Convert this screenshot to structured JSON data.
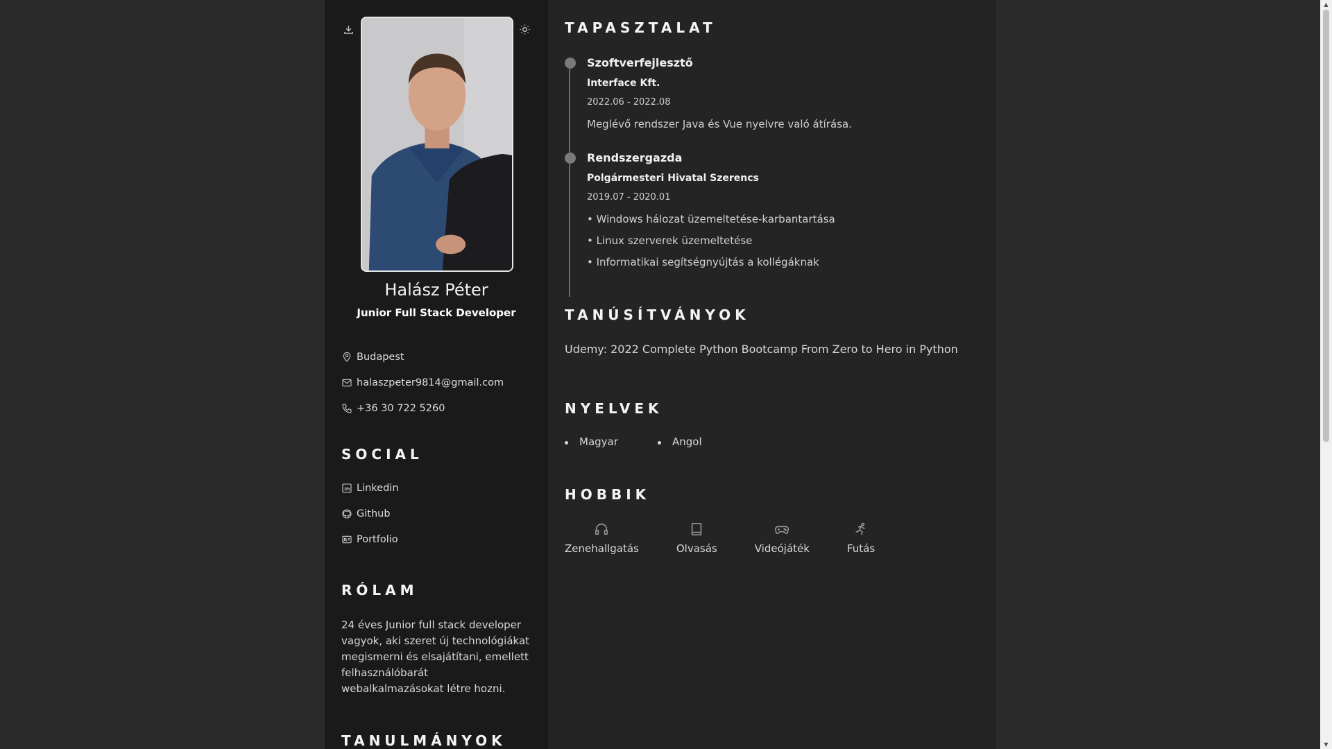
{
  "profile": {
    "name": "Halász Péter",
    "role": "Junior Full Stack Developer"
  },
  "toolbar": {
    "download_icon": "download-icon",
    "theme_icon": "sun-icon"
  },
  "contact": [
    {
      "icon": "location-icon",
      "text": "Budapest"
    },
    {
      "icon": "mail-icon",
      "text": "halaszpeter9814@gmail.com"
    },
    {
      "icon": "phone-icon",
      "text": "+36 30 722 5260"
    }
  ],
  "social": {
    "title": "SOCIAL",
    "items": [
      {
        "icon": "linkedin-icon",
        "label": "Linkedin"
      },
      {
        "icon": "github-icon",
        "label": "Github"
      },
      {
        "icon": "portfolio-icon",
        "label": "Portfolio"
      }
    ]
  },
  "about": {
    "title": "RÓLAM",
    "text": "24 éves Junior full stack developer vagyok, aki szeret új technológiákat megismerni és elsajátítani, emellett felhasználóbarát webalkalmazásokat létre hozni."
  },
  "studies": {
    "title": "TANULMÁNYOK"
  },
  "experience": {
    "title": "TAPASZTALAT",
    "jobs": [
      {
        "title": "Szoftverfejlesztő",
        "company": "Interface Kft.",
        "date": "2022.06 - 2022.08",
        "lines": [
          "Meglévő rendszer Java és Vue nyelvre való átírása."
        ]
      },
      {
        "title": "Rendszergazda",
        "company": "Polgármesteri Hivatal Szerencs",
        "date": "2019.07 - 2020.01",
        "lines": [
          "• Windows hálozat üzemeltetése-karbantartása",
          "• Linux szerverek üzemeltetése",
          "• Informatikai segítségnyújtás a kollégáknak"
        ]
      }
    ]
  },
  "certificates": {
    "title": "TANÚSÍTVÁNYOK",
    "items": [
      "Udemy: 2022 Complete Python Bootcamp From Zero to Hero in Python"
    ]
  },
  "languages": {
    "title": "NYELVEK",
    "items": [
      "Magyar",
      "Angol"
    ]
  },
  "hobbies": {
    "title": "HOBBIK",
    "items": [
      {
        "icon": "headphones-icon",
        "label": "Zenehallgatás"
      },
      {
        "icon": "book-icon",
        "label": "Olvasás"
      },
      {
        "icon": "gamepad-icon",
        "label": "Videójáték"
      },
      {
        "icon": "running-icon",
        "label": "Futás"
      }
    ]
  },
  "colors": {
    "page_bg": "#2b2b2b",
    "sidebar_bg": "#1b1a1a",
    "main_bg": "#252424"
  }
}
